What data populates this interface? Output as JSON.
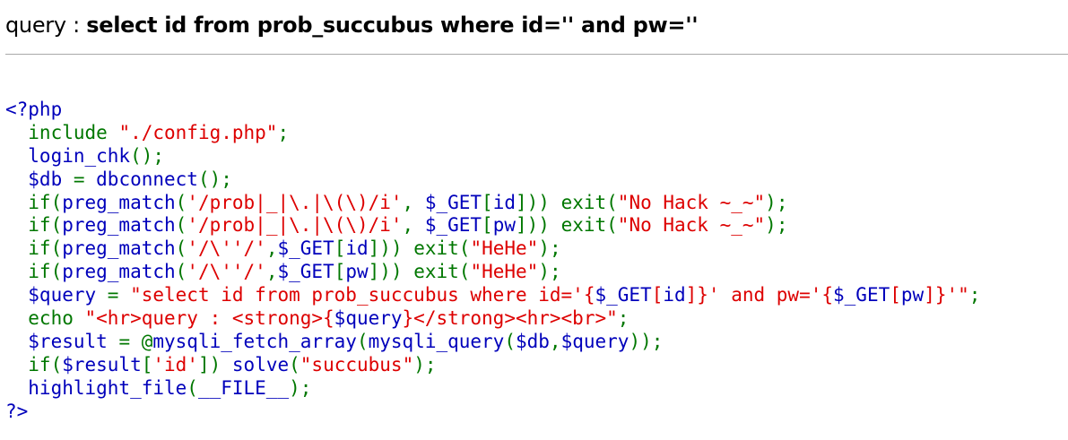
{
  "query_header": {
    "label": "query : ",
    "value": "select id from prob_succubus where id='' and pw=''"
  },
  "source_code": {
    "colors": {
      "default": "#0000bb",
      "keyword": "#007700",
      "string": "#dd0000"
    },
    "lines": [
      [
        {
          "t": "default",
          "s": "<?php"
        }
      ],
      [
        {
          "t": "keyword",
          "s": "  include "
        },
        {
          "t": "string",
          "s": "\"./config.php\""
        },
        {
          "t": "keyword",
          "s": ";"
        }
      ],
      [
        {
          "t": "default",
          "s": "  login_chk"
        },
        {
          "t": "keyword",
          "s": "();"
        }
      ],
      [
        {
          "t": "default",
          "s": "  $db "
        },
        {
          "t": "keyword",
          "s": "= "
        },
        {
          "t": "default",
          "s": "dbconnect"
        },
        {
          "t": "keyword",
          "s": "();"
        }
      ],
      [
        {
          "t": "keyword",
          "s": "  if("
        },
        {
          "t": "default",
          "s": "preg_match"
        },
        {
          "t": "keyword",
          "s": "("
        },
        {
          "t": "string",
          "s": "'/prob|_|\\.|\\(\\)/i'"
        },
        {
          "t": "keyword",
          "s": ", "
        },
        {
          "t": "default",
          "s": "$_GET"
        },
        {
          "t": "keyword",
          "s": "["
        },
        {
          "t": "default",
          "s": "id"
        },
        {
          "t": "keyword",
          "s": "])) exit("
        },
        {
          "t": "string",
          "s": "\"No Hack ~_~\""
        },
        {
          "t": "keyword",
          "s": ");"
        }
      ],
      [
        {
          "t": "keyword",
          "s": "  if("
        },
        {
          "t": "default",
          "s": "preg_match"
        },
        {
          "t": "keyword",
          "s": "("
        },
        {
          "t": "string",
          "s": "'/prob|_|\\.|\\(\\)/i'"
        },
        {
          "t": "keyword",
          "s": ", "
        },
        {
          "t": "default",
          "s": "$_GET"
        },
        {
          "t": "keyword",
          "s": "["
        },
        {
          "t": "default",
          "s": "pw"
        },
        {
          "t": "keyword",
          "s": "])) exit("
        },
        {
          "t": "string",
          "s": "\"No Hack ~_~\""
        },
        {
          "t": "keyword",
          "s": ");"
        }
      ],
      [
        {
          "t": "keyword",
          "s": "  if("
        },
        {
          "t": "default",
          "s": "preg_match"
        },
        {
          "t": "keyword",
          "s": "("
        },
        {
          "t": "string",
          "s": "'/\\''/'"
        },
        {
          "t": "keyword",
          "s": ","
        },
        {
          "t": "default",
          "s": "$_GET"
        },
        {
          "t": "keyword",
          "s": "["
        },
        {
          "t": "default",
          "s": "id"
        },
        {
          "t": "keyword",
          "s": "])) exit("
        },
        {
          "t": "string",
          "s": "\"HeHe\""
        },
        {
          "t": "keyword",
          "s": ");"
        }
      ],
      [
        {
          "t": "keyword",
          "s": "  if("
        },
        {
          "t": "default",
          "s": "preg_match"
        },
        {
          "t": "keyword",
          "s": "("
        },
        {
          "t": "string",
          "s": "'/\\''/'"
        },
        {
          "t": "keyword",
          "s": ","
        },
        {
          "t": "default",
          "s": "$_GET"
        },
        {
          "t": "keyword",
          "s": "["
        },
        {
          "t": "default",
          "s": "pw"
        },
        {
          "t": "keyword",
          "s": "])) exit("
        },
        {
          "t": "string",
          "s": "\"HeHe\""
        },
        {
          "t": "keyword",
          "s": ");"
        }
      ],
      [
        {
          "t": "default",
          "s": "  $query "
        },
        {
          "t": "keyword",
          "s": "= "
        },
        {
          "t": "string",
          "s": "\"select id from prob_succubus where id='{"
        },
        {
          "t": "default",
          "s": "$_GET"
        },
        {
          "t": "string",
          "s": "["
        },
        {
          "t": "default",
          "s": "id"
        },
        {
          "t": "string",
          "s": "]}' and pw='{"
        },
        {
          "t": "default",
          "s": "$_GET"
        },
        {
          "t": "string",
          "s": "["
        },
        {
          "t": "default",
          "s": "pw"
        },
        {
          "t": "string",
          "s": "]}'\""
        },
        {
          "t": "keyword",
          "s": ";"
        }
      ],
      [
        {
          "t": "keyword",
          "s": "  echo "
        },
        {
          "t": "string",
          "s": "\"<hr>query : <strong>{"
        },
        {
          "t": "default",
          "s": "$query"
        },
        {
          "t": "string",
          "s": "}</strong><hr><br>\""
        },
        {
          "t": "keyword",
          "s": ";"
        }
      ],
      [
        {
          "t": "default",
          "s": "  $result "
        },
        {
          "t": "keyword",
          "s": "= @"
        },
        {
          "t": "default",
          "s": "mysqli_fetch_array"
        },
        {
          "t": "keyword",
          "s": "("
        },
        {
          "t": "default",
          "s": "mysqli_query"
        },
        {
          "t": "keyword",
          "s": "("
        },
        {
          "t": "default",
          "s": "$db"
        },
        {
          "t": "keyword",
          "s": ","
        },
        {
          "t": "default",
          "s": "$query"
        },
        {
          "t": "keyword",
          "s": "));"
        }
      ],
      [
        {
          "t": "keyword",
          "s": "  if("
        },
        {
          "t": "default",
          "s": "$result"
        },
        {
          "t": "keyword",
          "s": "["
        },
        {
          "t": "string",
          "s": "'id'"
        },
        {
          "t": "keyword",
          "s": "]) "
        },
        {
          "t": "default",
          "s": "solve"
        },
        {
          "t": "keyword",
          "s": "("
        },
        {
          "t": "string",
          "s": "\"succubus\""
        },
        {
          "t": "keyword",
          "s": ");"
        }
      ],
      [
        {
          "t": "default",
          "s": "  highlight_file"
        },
        {
          "t": "keyword",
          "s": "("
        },
        {
          "t": "default",
          "s": "__FILE__"
        },
        {
          "t": "keyword",
          "s": ");"
        }
      ],
      [
        {
          "t": "default",
          "s": "?>"
        }
      ]
    ]
  }
}
